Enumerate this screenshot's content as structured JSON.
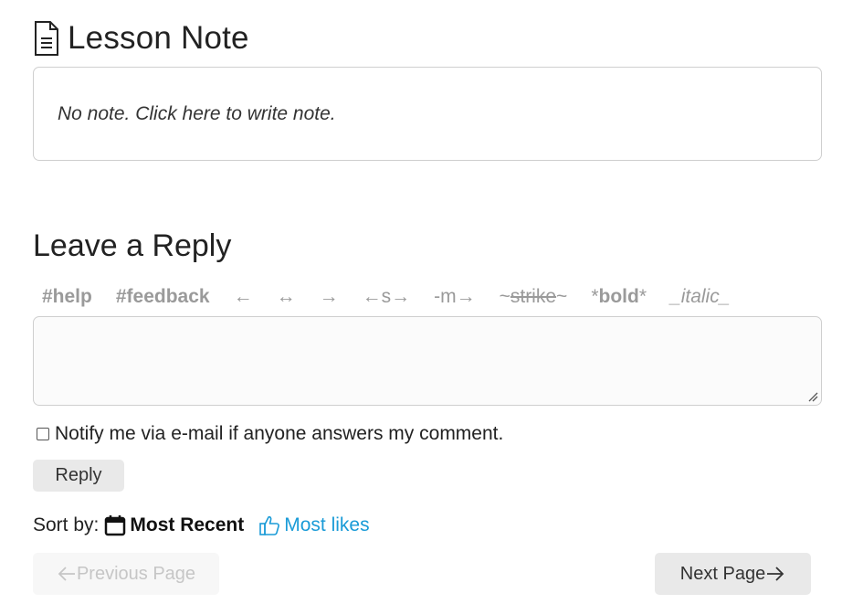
{
  "lesson_note": {
    "title": "Lesson Note",
    "placeholder": "No note. Click here to write note."
  },
  "reply": {
    "title": "Leave a Reply",
    "format_items": [
      {
        "label": "#help"
      },
      {
        "label": "#feedback"
      },
      {
        "label": "←"
      },
      {
        "label": "↔"
      },
      {
        "label": "→"
      },
      {
        "label": "←s→"
      },
      {
        "label": "-m→"
      },
      {
        "prefix": "~",
        "label": "strike",
        "suffix": "~"
      },
      {
        "prefix": "*",
        "label": "bold",
        "suffix": "*"
      },
      {
        "label": "_italic_"
      }
    ],
    "textarea_value": "",
    "notify_label": "Notify me via e-mail if anyone answers my comment.",
    "notify_checked": false,
    "reply_button": "Reply"
  },
  "sort": {
    "label": "Sort by:",
    "options": [
      {
        "label": "Most Recent",
        "icon": "calendar-icon",
        "active": true
      },
      {
        "label": "Most likes",
        "icon": "thumbs-up-icon",
        "active": false
      }
    ],
    "link_color": "#1a9bd7"
  },
  "pagination": {
    "previous": "Previous Page",
    "next": "Next Page",
    "previous_disabled": true
  }
}
